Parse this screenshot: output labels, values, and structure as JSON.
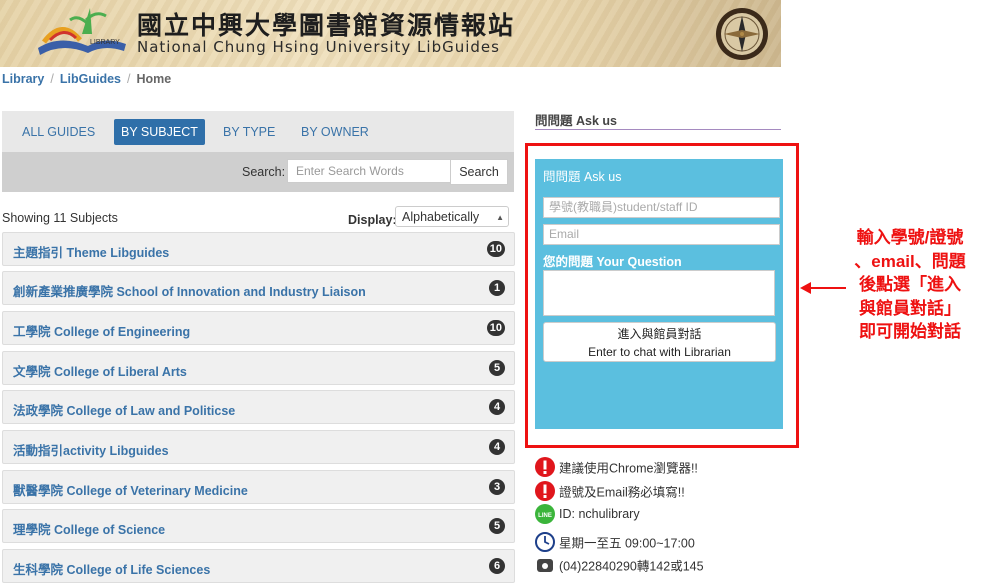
{
  "banner": {
    "title_zh": "國立中興大學圖書館資源情報站",
    "title_en": "National Chung Hsing University LibGuides",
    "logo_text": "LIBRARY"
  },
  "breadcrumb": {
    "items": [
      "Library",
      "LibGuides",
      "Home"
    ]
  },
  "tabs": [
    {
      "label": "ALL GUIDES",
      "active": false
    },
    {
      "label": "BY SUBJECT",
      "active": true
    },
    {
      "label": "BY TYPE",
      "active": false
    },
    {
      "label": "BY OWNER",
      "active": false
    }
  ],
  "search": {
    "label": "Search:",
    "placeholder": "Enter Search Words",
    "button": "Search"
  },
  "listing": {
    "showing": "Showing 11 Subjects",
    "display_label": "Display:",
    "display_value": "Alphabetically"
  },
  "subjects": [
    {
      "name": "主題指引 Theme Libguides",
      "count": "10"
    },
    {
      "name": "創新產業推廣學院 School of Innovation and Industry Liaison",
      "count": "1"
    },
    {
      "name": "工學院 College of Engineering",
      "count": "10"
    },
    {
      "name": "文學院 College of Liberal Arts",
      "count": "5"
    },
    {
      "name": "法政學院 College of Law and Politicse",
      "count": "4"
    },
    {
      "name": "活動指引activity Libguides",
      "count": "4"
    },
    {
      "name": "獸醫學院 College of Veterinary Medicine",
      "count": "3"
    },
    {
      "name": "理學院 College of Science",
      "count": "5"
    },
    {
      "name": "生科學院 College of Life Sciences",
      "count": "6"
    }
  ],
  "ask": {
    "heading": "問問題 Ask us",
    "widget_title": "問問題 Ask us",
    "id_placeholder": "學號(教職員)student/staff ID",
    "email_placeholder": "Email",
    "question_label": "您的問題 Your Question",
    "button_line1": "進入與館員對話",
    "button_line2": "Enter to chat with Librarian"
  },
  "annotation": [
    "輸入學號/證號",
    "、email、問題",
    "後點選「進入",
    "與館員對話」",
    "即可開始對話"
  ],
  "notices": [
    {
      "icon": "exclamation-icon",
      "text": "建議使用Chrome瀏覽器!!"
    },
    {
      "icon": "exclamation-icon",
      "text": "證號及Email務必填寫!!"
    },
    {
      "icon": "line-icon",
      "text": "ID: nchulibrary"
    },
    {
      "icon": "clock-icon",
      "text": "星期一至五 09:00~17:00"
    },
    {
      "icon": "phone-icon",
      "text": "(04)22840290轉142或145"
    }
  ],
  "colors": {
    "link": "#3a73a8",
    "active_tab": "#2f6fa9",
    "widget_bg": "#5bbfdf",
    "highlight": "#e11111"
  }
}
